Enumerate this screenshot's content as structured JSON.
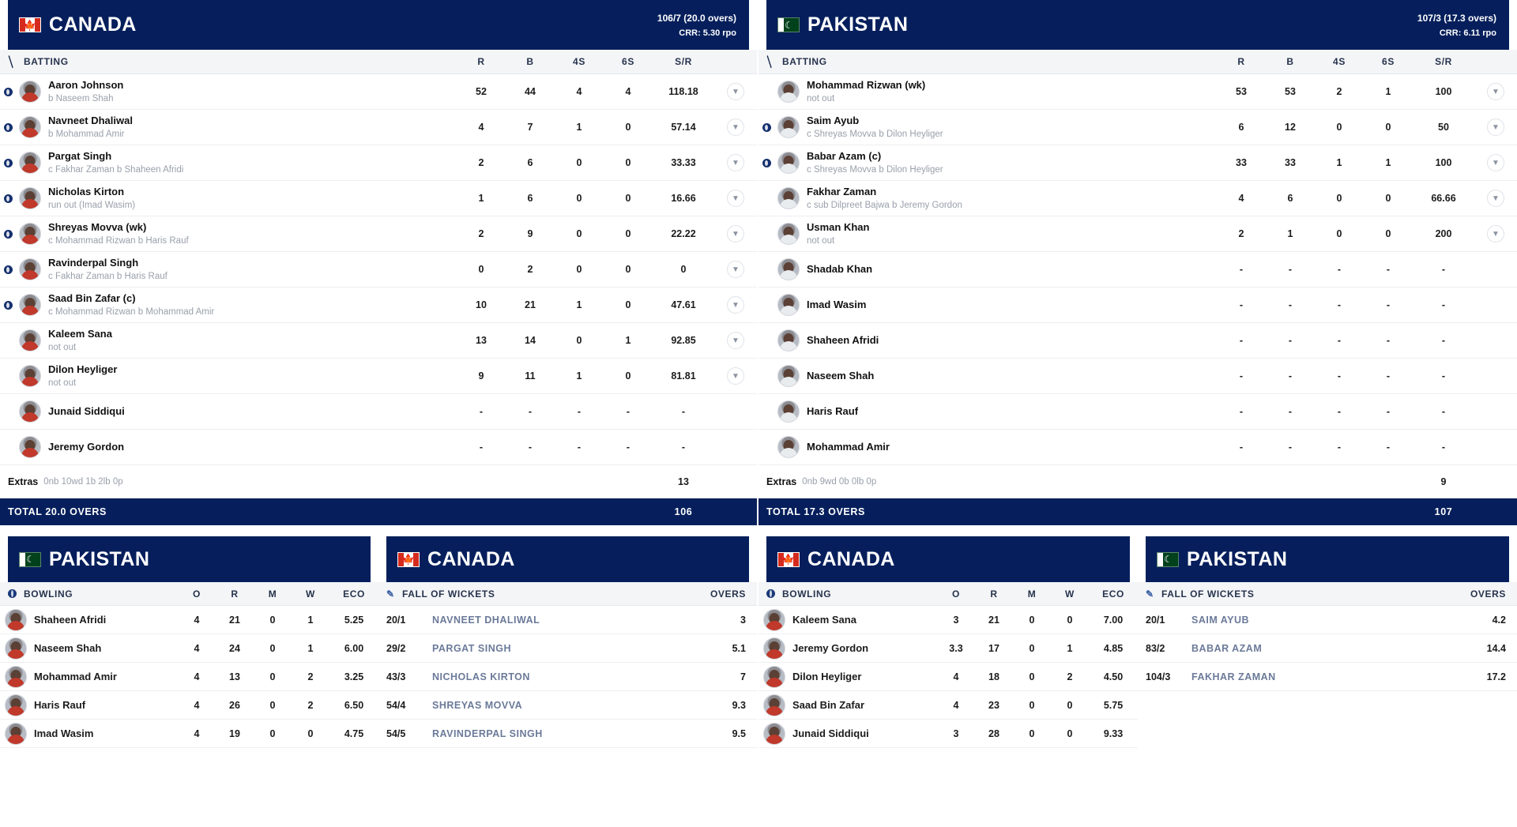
{
  "columns": {
    "batting_label": "BATTING",
    "r": "R",
    "b": "B",
    "fours": "4S",
    "sixes": "6S",
    "sr": "S/R",
    "bowling_label": "BOWLING",
    "o": "O",
    "br": "R",
    "m": "M",
    "w": "W",
    "eco": "ECO",
    "fow_label": "FALL OF WICKETS",
    "overs": "OVERS"
  },
  "innings": [
    {
      "team": "CANADA",
      "flag": "canada-flag-icon",
      "score": "106/7 (20.0 overs)",
      "crr": "CRR: 5.30 rpo",
      "batsmen": [
        {
          "out": true,
          "name": "Aaron Johnson",
          "how": "b Naseem Shah",
          "r": "52",
          "b": "44",
          "fours": "4",
          "sixes": "4",
          "sr": "118.18",
          "chevron": true
        },
        {
          "out": true,
          "name": "Navneet Dhaliwal",
          "how": "b Mohammad Amir",
          "r": "4",
          "b": "7",
          "fours": "1",
          "sixes": "0",
          "sr": "57.14",
          "chevron": true
        },
        {
          "out": true,
          "name": "Pargat Singh",
          "how": "c Fakhar Zaman b Shaheen Afridi",
          "r": "2",
          "b": "6",
          "fours": "0",
          "sixes": "0",
          "sr": "33.33",
          "chevron": true
        },
        {
          "out": true,
          "name": "Nicholas Kirton",
          "how": "run out (Imad Wasim)",
          "r": "1",
          "b": "6",
          "fours": "0",
          "sixes": "0",
          "sr": "16.66",
          "chevron": true
        },
        {
          "out": true,
          "name": "Shreyas Movva (wk)",
          "how": "c Mohammad Rizwan b Haris Rauf",
          "r": "2",
          "b": "9",
          "fours": "0",
          "sixes": "0",
          "sr": "22.22",
          "chevron": true
        },
        {
          "out": true,
          "name": "Ravinderpal Singh",
          "how": "c Fakhar Zaman b Haris Rauf",
          "r": "0",
          "b": "2",
          "fours": "0",
          "sixes": "0",
          "sr": "0",
          "chevron": true
        },
        {
          "out": true,
          "name": "Saad Bin Zafar (c)",
          "how": "c Mohammad Rizwan b Mohammad Amir",
          "r": "10",
          "b": "21",
          "fours": "1",
          "sixes": "0",
          "sr": "47.61",
          "chevron": true
        },
        {
          "out": false,
          "name": "Kaleem Sana",
          "how": "not out",
          "r": "13",
          "b": "14",
          "fours": "0",
          "sixes": "1",
          "sr": "92.85",
          "chevron": true
        },
        {
          "out": false,
          "name": "Dilon Heyliger",
          "how": "not out",
          "r": "9",
          "b": "11",
          "fours": "1",
          "sixes": "0",
          "sr": "81.81",
          "chevron": true
        },
        {
          "out": false,
          "name": "Junaid Siddiqui",
          "how": "",
          "r": "-",
          "b": "-",
          "fours": "-",
          "sixes": "-",
          "sr": "-",
          "chevron": false
        },
        {
          "out": false,
          "name": "Jeremy Gordon",
          "how": "",
          "r": "-",
          "b": "-",
          "fours": "-",
          "sixes": "-",
          "sr": "-",
          "chevron": false
        }
      ],
      "extras": {
        "label": "Extras",
        "detail": "0nb 10wd 1b 2lb 0p",
        "value": "13"
      },
      "total": {
        "label": "TOTAL  20.0 OVERS",
        "value": "106"
      }
    },
    {
      "team": "PAKISTAN",
      "flag": "pakistan-flag-icon",
      "score": "107/3 (17.3 overs)",
      "crr": "CRR: 6.11 rpo",
      "batsmen": [
        {
          "out": false,
          "name": "Mohammad Rizwan (wk)",
          "how": "not out",
          "r": "53",
          "b": "53",
          "fours": "2",
          "sixes": "1",
          "sr": "100",
          "chevron": true
        },
        {
          "out": true,
          "name": "Saim Ayub",
          "how": "c Shreyas Movva b Dilon Heyliger",
          "r": "6",
          "b": "12",
          "fours": "0",
          "sixes": "0",
          "sr": "50",
          "chevron": true
        },
        {
          "out": true,
          "name": "Babar Azam (c)",
          "how": "c Shreyas Movva b Dilon Heyliger",
          "r": "33",
          "b": "33",
          "fours": "1",
          "sixes": "1",
          "sr": "100",
          "chevron": true
        },
        {
          "out": false,
          "name": "Fakhar Zaman",
          "how": "c sub Dilpreet Bajwa b Jeremy Gordon",
          "r": "4",
          "b": "6",
          "fours": "0",
          "sixes": "0",
          "sr": "66.66",
          "chevron": true
        },
        {
          "out": false,
          "name": "Usman Khan",
          "how": "not out",
          "r": "2",
          "b": "1",
          "fours": "0",
          "sixes": "0",
          "sr": "200",
          "chevron": true
        },
        {
          "out": false,
          "name": "Shadab Khan",
          "how": "",
          "r": "-",
          "b": "-",
          "fours": "-",
          "sixes": "-",
          "sr": "-",
          "chevron": false
        },
        {
          "out": false,
          "name": "Imad Wasim",
          "how": "",
          "r": "-",
          "b": "-",
          "fours": "-",
          "sixes": "-",
          "sr": "-",
          "chevron": false
        },
        {
          "out": false,
          "name": "Shaheen Afridi",
          "how": "",
          "r": "-",
          "b": "-",
          "fours": "-",
          "sixes": "-",
          "sr": "-",
          "chevron": false
        },
        {
          "out": false,
          "name": "Naseem Shah",
          "how": "",
          "r": "-",
          "b": "-",
          "fours": "-",
          "sixes": "-",
          "sr": "-",
          "chevron": false
        },
        {
          "out": false,
          "name": "Haris Rauf",
          "how": "",
          "r": "-",
          "b": "-",
          "fours": "-",
          "sixes": "-",
          "sr": "-",
          "chevron": false
        },
        {
          "out": false,
          "name": "Mohammad Amir",
          "how": "",
          "r": "-",
          "b": "-",
          "fours": "-",
          "sixes": "-",
          "sr": "-",
          "chevron": false
        }
      ],
      "extras": {
        "label": "Extras",
        "detail": "0nb 9wd 0b 0lb 0p",
        "value": "9"
      },
      "total": {
        "label": "TOTAL  17.3 OVERS",
        "value": "107"
      }
    }
  ],
  "bowling_panels": [
    {
      "team": "PAKISTAN",
      "flag": "pakistan-flag-icon",
      "rows": [
        {
          "name": "Shaheen Afridi",
          "o": "4",
          "r": "21",
          "m": "0",
          "w": "1",
          "eco": "5.25"
        },
        {
          "name": "Naseem Shah",
          "o": "4",
          "r": "24",
          "m": "0",
          "w": "1",
          "eco": "6.00"
        },
        {
          "name": "Mohammad Amir",
          "o": "4",
          "r": "13",
          "m": "0",
          "w": "2",
          "eco": "3.25"
        },
        {
          "name": "Haris Rauf",
          "o": "4",
          "r": "26",
          "m": "0",
          "w": "2",
          "eco": "6.50"
        },
        {
          "name": "Imad Wasim",
          "o": "4",
          "r": "19",
          "m": "0",
          "w": "0",
          "eco": "4.75"
        }
      ]
    },
    {
      "team": "CANADA",
      "flag": "canada-flag-icon",
      "rows": [
        {
          "name": "Kaleem Sana",
          "o": "3",
          "r": "21",
          "m": "0",
          "w": "0",
          "eco": "7.00"
        },
        {
          "name": "Jeremy Gordon",
          "o": "3.3",
          "r": "17",
          "m": "0",
          "w": "1",
          "eco": "4.85"
        },
        {
          "name": "Dilon Heyliger",
          "o": "4",
          "r": "18",
          "m": "0",
          "w": "2",
          "eco": "4.50"
        },
        {
          "name": "Saad Bin Zafar",
          "o": "4",
          "r": "23",
          "m": "0",
          "w": "0",
          "eco": "5.75"
        },
        {
          "name": "Junaid Siddiqui",
          "o": "3",
          "r": "28",
          "m": "0",
          "w": "0",
          "eco": "9.33"
        }
      ]
    }
  ],
  "fow_panels": [
    {
      "team": "CANADA",
      "flag": "canada-flag-icon",
      "rows": [
        {
          "score": "20/1",
          "name": "NAVNEET DHALIWAL",
          "over": "3"
        },
        {
          "score": "29/2",
          "name": "PARGAT SINGH",
          "over": "5.1"
        },
        {
          "score": "43/3",
          "name": "NICHOLAS KIRTON",
          "over": "7"
        },
        {
          "score": "54/4",
          "name": "SHREYAS MOVVA",
          "over": "9.3"
        },
        {
          "score": "54/5",
          "name": "RAVINDERPAL SINGH",
          "over": "9.5"
        }
      ]
    },
    {
      "team": "PAKISTAN",
      "flag": "pakistan-flag-icon",
      "rows": [
        {
          "score": "20/1",
          "name": "SAIM AYUB",
          "over": "4.2"
        },
        {
          "score": "83/2",
          "name": "BABAR AZAM",
          "over": "14.4"
        },
        {
          "score": "104/3",
          "name": "FAKHAR ZAMAN",
          "over": "17.2"
        }
      ]
    }
  ],
  "colors": {
    "header_navy": "#061f5c",
    "column_bg": "#f4f5f7",
    "fow_name": "#6b7a99",
    "muted_text": "#9aa0ab"
  }
}
